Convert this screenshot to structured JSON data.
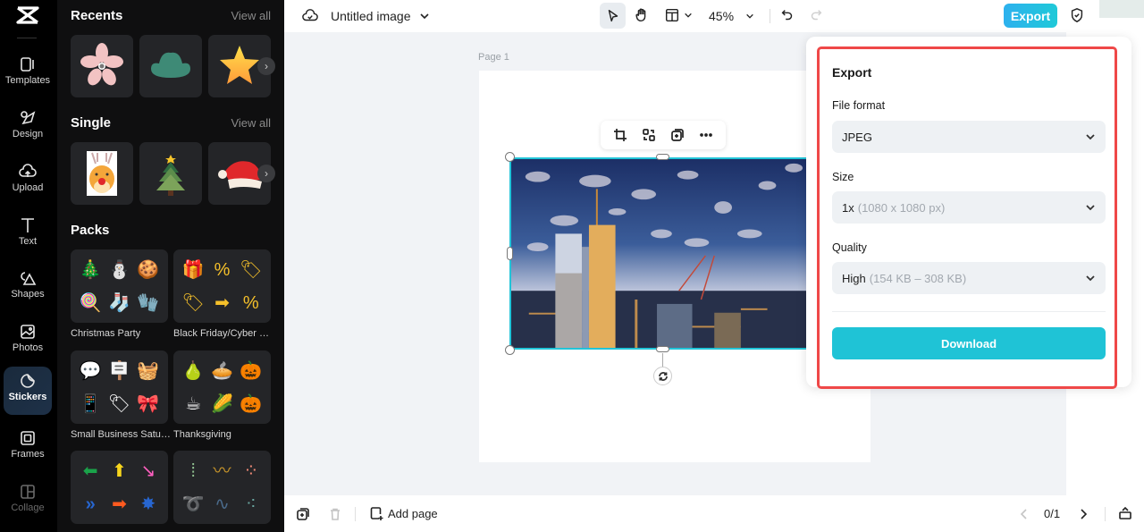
{
  "app": {
    "logo_icon": "capcut-logo-icon"
  },
  "rail": {
    "items": [
      {
        "label": "Templates",
        "icon": "templates-icon"
      },
      {
        "label": "Design",
        "icon": "design-icon"
      },
      {
        "label": "Upload",
        "icon": "upload-cloud-icon"
      },
      {
        "label": "Text",
        "icon": "text-icon"
      },
      {
        "label": "Shapes",
        "icon": "shapes-icon"
      },
      {
        "label": "Photos",
        "icon": "photos-icon"
      },
      {
        "label": "Stickers",
        "icon": "sticker-icon",
        "active": true
      },
      {
        "label": "Frames",
        "icon": "frames-icon"
      },
      {
        "label": "Collage",
        "icon": "collage-icon"
      }
    ]
  },
  "panel": {
    "recents": {
      "title": "Recents",
      "view_all": "View all",
      "items": [
        "pink flower",
        "green leaf plant",
        "gold star"
      ]
    },
    "single": {
      "title": "Single",
      "view_all": "View all",
      "items": [
        "reindeer",
        "christmas tree",
        "santa hat"
      ]
    },
    "packs": {
      "title": "Packs",
      "items": [
        {
          "label": "Christmas Party",
          "stickers": [
            "🎄",
            "⛄",
            "🍪",
            "🍭",
            "🧦",
            "🧤"
          ]
        },
        {
          "label": "Black Friday/Cyber M...",
          "stickers": [
            "🎁",
            "%",
            "🏷",
            "🏷",
            "➡",
            "%"
          ]
        },
        {
          "label": "Small Business Saturd...",
          "stickers": [
            "💬",
            "🪧",
            "🧺",
            "📱",
            "🏷",
            "🎀"
          ]
        },
        {
          "label": "Thanksgiving",
          "stickers": [
            "🍐",
            "🥧",
            "🎃",
            "☕",
            "🌽",
            "🎃"
          ]
        },
        {
          "label": "",
          "stickers": [
            "⬅",
            "⬆",
            "↘",
            "»",
            "➡",
            "✸"
          ]
        },
        {
          "label": "",
          "stickers": [
            "⁞",
            "〰",
            "⁘",
            "➰",
            "∿",
            "⁖"
          ]
        }
      ]
    }
  },
  "topbar": {
    "doc_title": "Untitled image",
    "zoom": "45%",
    "export_label": "Export"
  },
  "canvas": {
    "page_label": "Page 1"
  },
  "export_panel": {
    "title": "Export",
    "file_format": {
      "label": "File format",
      "value": "JPEG"
    },
    "size": {
      "label": "Size",
      "value": "1x",
      "detail": "(1080 x 1080 px)"
    },
    "quality": {
      "label": "Quality",
      "value": "High",
      "detail": "(154 KB – 308 KB)"
    },
    "download_label": "Download"
  },
  "bottombar": {
    "add_page_label": "Add page",
    "page_counter": "0/1"
  },
  "colors": {
    "accent": "#1fc3d6",
    "highlight": "#ef4848",
    "selection": "#21c4d8"
  }
}
